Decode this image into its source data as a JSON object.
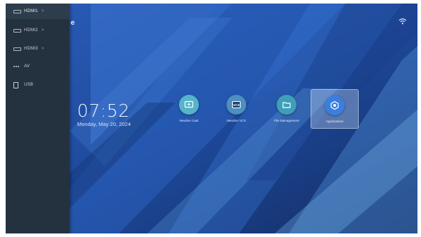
{
  "sidebar": {
    "items": [
      {
        "label": "HDMI1",
        "chevron": ">",
        "icon": "hdmi-port-icon",
        "active": true
      },
      {
        "label": "HDMI2",
        "chevron": ">",
        "icon": "hdmi-port-icon",
        "active": false
      },
      {
        "label": "HDMI3",
        "chevron": ">",
        "icon": "hdmi-port-icon",
        "active": false
      },
      {
        "label": "AV",
        "chevron": "",
        "icon": "av-icon",
        "active": false
      },
      {
        "label": "USB",
        "chevron": "",
        "icon": "usb-icon",
        "active": false
      }
    ]
  },
  "home": {
    "edge_char": "e",
    "time": "07:52",
    "date": "Monday, May 20, 2024"
  },
  "status": {
    "wifi_icon": "wifi-icon"
  },
  "apps": [
    {
      "name": "Newline Cast",
      "icon": "cast-icon",
      "color": "#56b3c9"
    },
    {
      "name": "Newline VCS",
      "icon": "vcs-icon",
      "color": "#4d8fc0"
    },
    {
      "name": "File Management",
      "icon": "folder-icon",
      "color": "#3f9fb8"
    },
    {
      "name": "Applications",
      "icon": "apps-icon",
      "color": "#3a7fe0",
      "selected": true
    }
  ]
}
